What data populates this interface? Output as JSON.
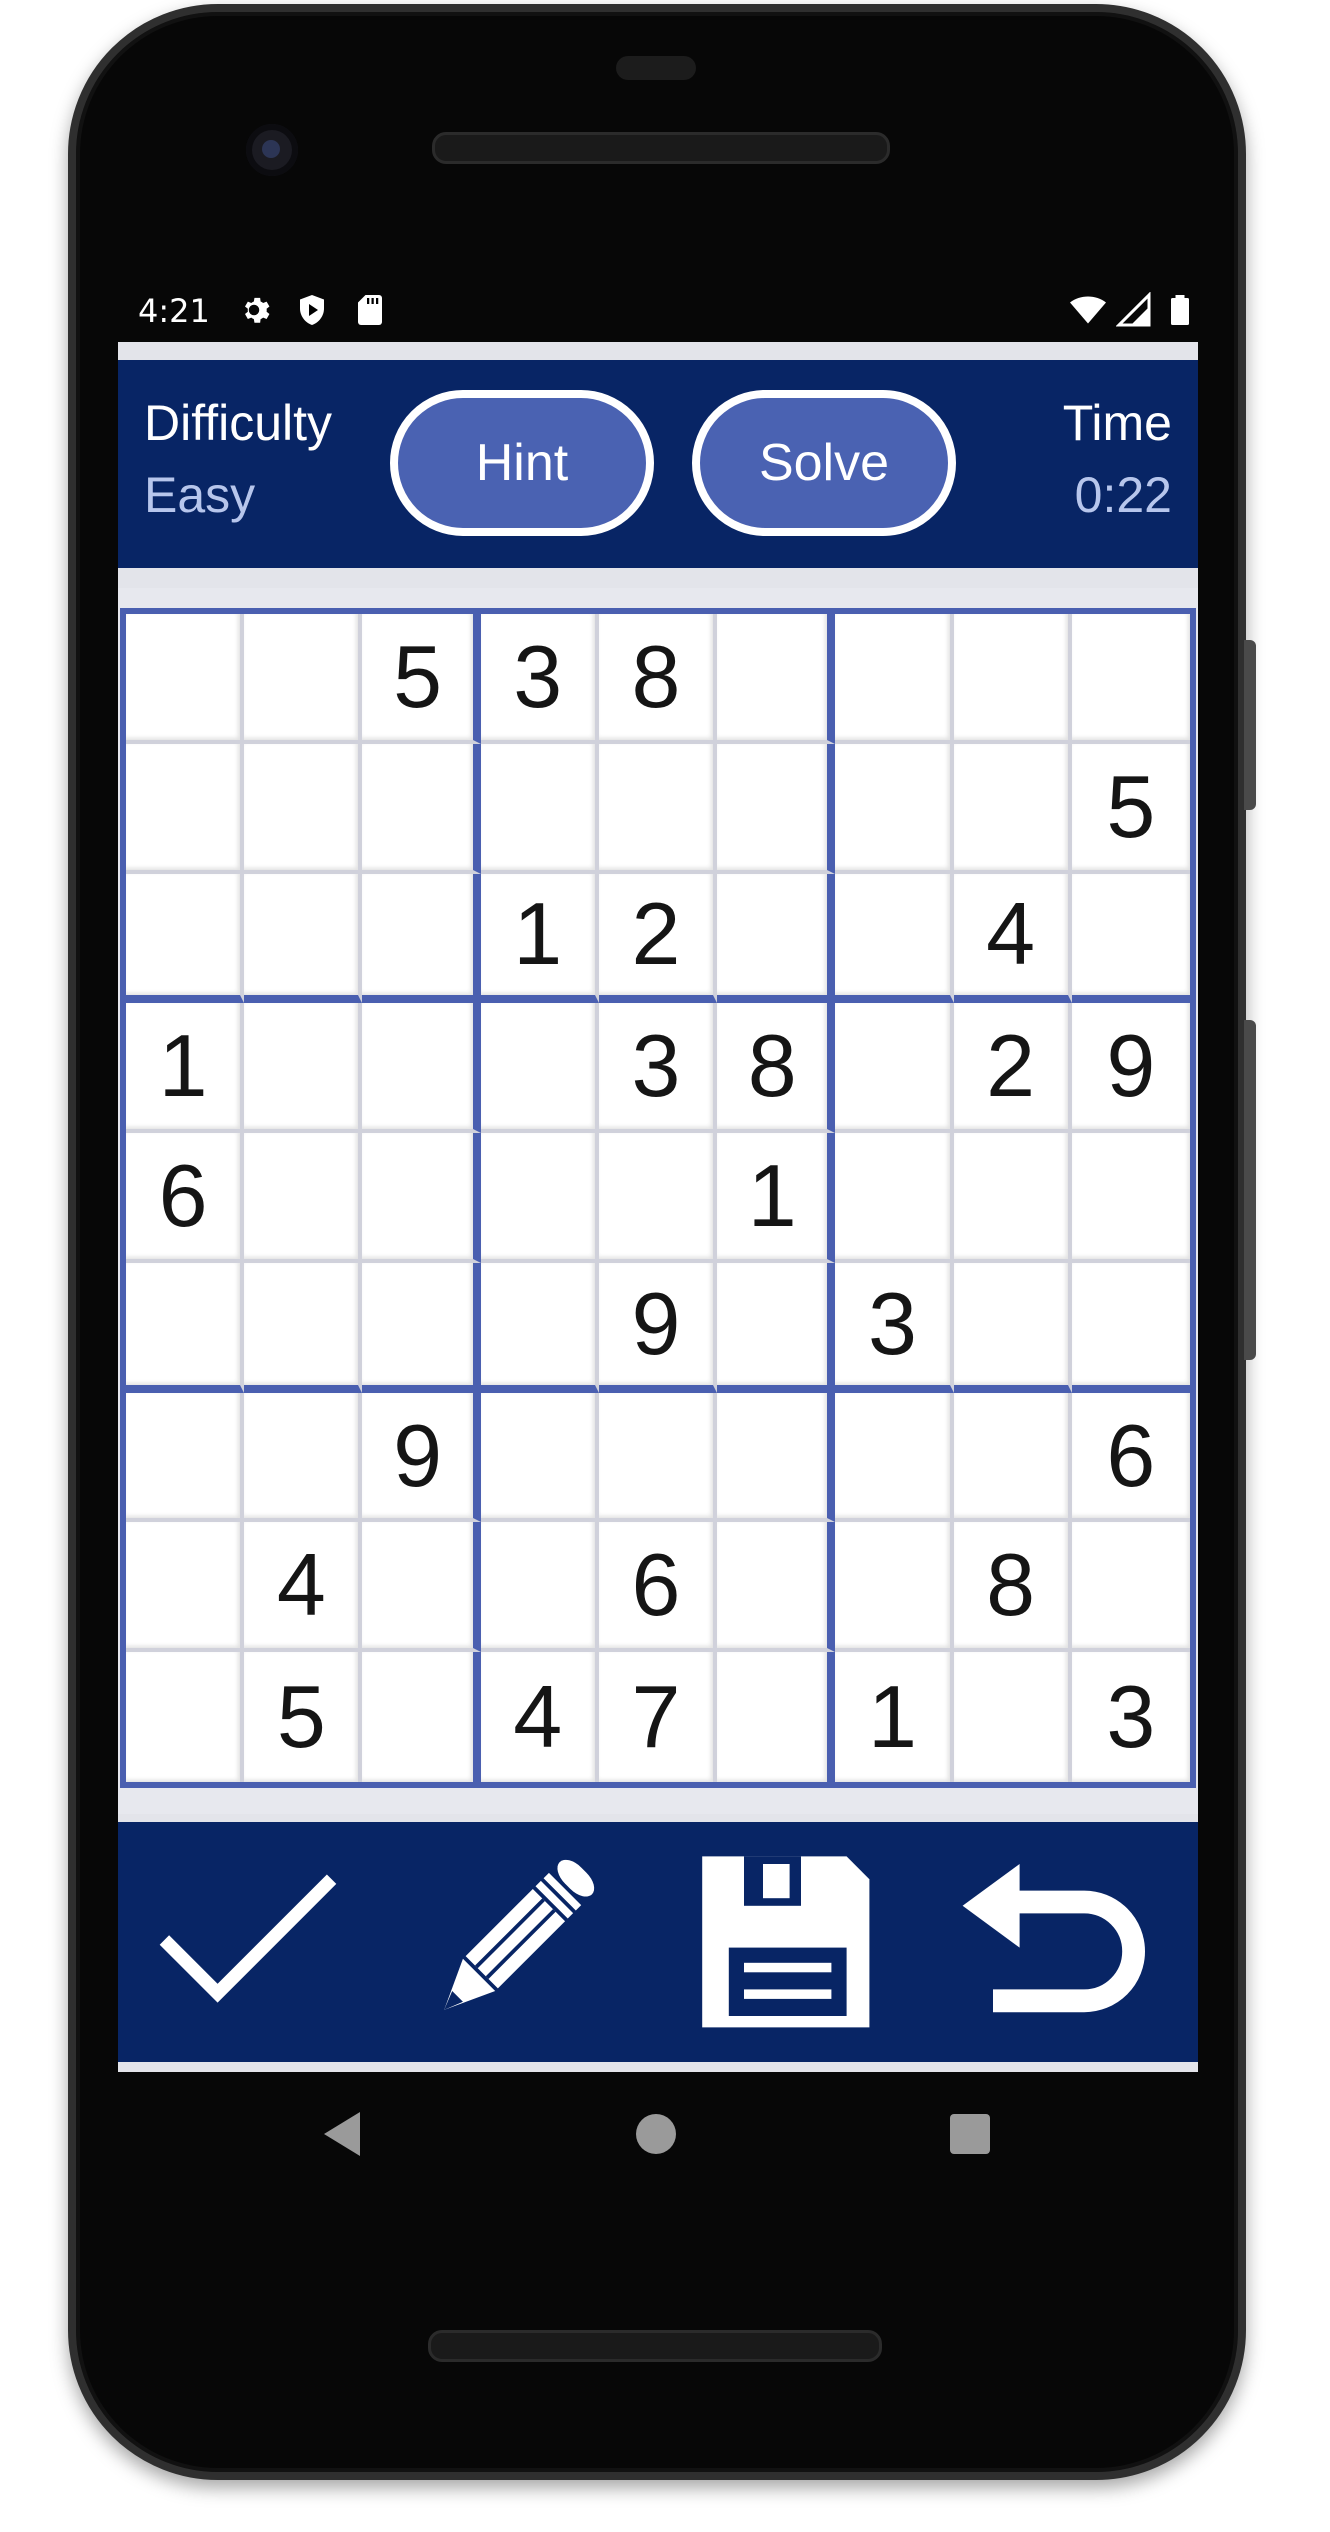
{
  "status_bar": {
    "time": "4:21",
    "left_icons": [
      "gear-icon",
      "shield-play-icon",
      "sd-card-icon"
    ],
    "right_icons": [
      "wifi-icon",
      "signal-icon",
      "battery-icon"
    ]
  },
  "header": {
    "difficulty_label": "Difficulty",
    "difficulty_value": "Easy",
    "hint_label": "Hint",
    "solve_label": "Solve",
    "time_label": "Time",
    "time_value": "0:22"
  },
  "board": {
    "rows": [
      [
        "",
        "",
        "5",
        "3",
        "8",
        "",
        "",
        "",
        ""
      ],
      [
        "",
        "",
        "",
        "",
        "",
        "",
        "",
        "",
        "5"
      ],
      [
        "",
        "",
        "",
        "1",
        "2",
        "",
        "",
        "4",
        ""
      ],
      [
        "1",
        "",
        "",
        "",
        "3",
        "8",
        "",
        "2",
        "9"
      ],
      [
        "6",
        "",
        "",
        "",
        "",
        "1",
        "",
        "",
        ""
      ],
      [
        "",
        "",
        "",
        "",
        "9",
        "",
        "3",
        "",
        ""
      ],
      [
        "",
        "",
        "9",
        "",
        "",
        "",
        "",
        "",
        "6"
      ],
      [
        "",
        "4",
        "",
        "",
        "6",
        "",
        "",
        "8",
        ""
      ],
      [
        "",
        "5",
        "",
        "4",
        "7",
        "",
        "1",
        "",
        "3"
      ]
    ]
  },
  "toolbar": {
    "buttons": [
      "check-icon",
      "pencil-icon",
      "save-icon",
      "undo-icon"
    ]
  },
  "navigation": {
    "buttons": [
      "back-icon",
      "home-icon",
      "recents-icon"
    ]
  },
  "colors": {
    "app_bar": "#082565",
    "accent": "#4a62b2",
    "box_lines": "#4a5fb0",
    "secondary_text": "#b7c6ec"
  }
}
